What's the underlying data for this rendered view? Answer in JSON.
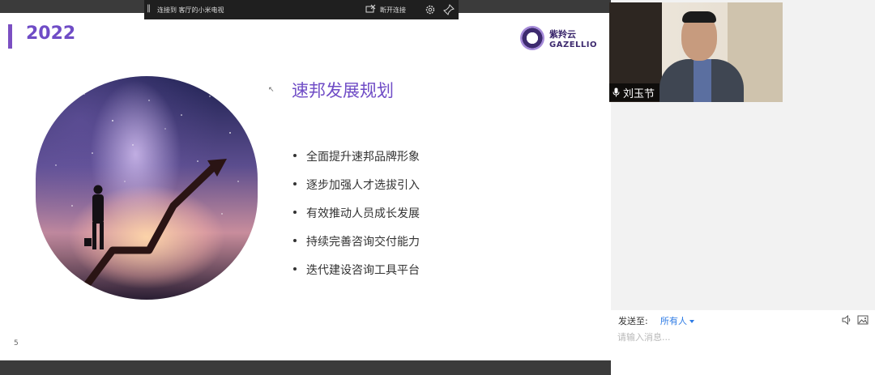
{
  "remote_bar": {
    "connection_text": "连接到 客厅的小米电视",
    "disconnect_label": "断开连接"
  },
  "slide": {
    "year": "2022",
    "logo_cn": "紫羚云",
    "logo_en": "GAZELLIO",
    "title": "速邦发展规划",
    "bullets": [
      "全面提升速邦品牌形象",
      "逐步加强人才选拔引入",
      "有效推动人员成长发展",
      "持续完善咨询交付能力",
      "迭代建设咨询工具平台"
    ],
    "page_number": "5"
  },
  "video": {
    "participant_name": "刘玉节"
  },
  "chat": {
    "send_to_label": "发送至:",
    "recipient": "所有人",
    "input_placeholder": "请输入消息..."
  },
  "colors": {
    "accent": "#6f4cc6",
    "link": "#2d7be5"
  }
}
